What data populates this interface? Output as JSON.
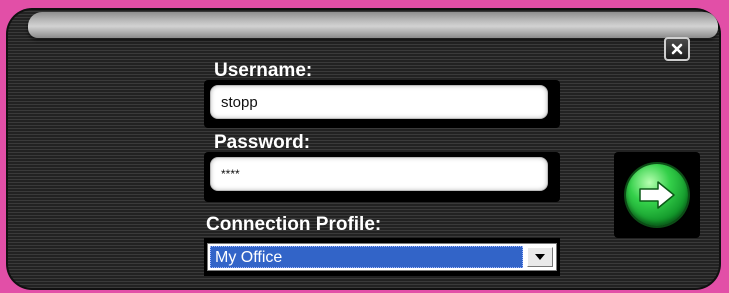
{
  "login": {
    "username_label": "Username:",
    "username_value": "stopp",
    "password_label": "Password:",
    "password_value": "****",
    "profile_label": "Connection Profile:",
    "profile_selected": "My Office"
  },
  "icons": {
    "close": "close-icon",
    "go": "arrow-right-icon",
    "dropdown": "chevron-down-icon"
  },
  "colors": {
    "panel": "#2e2e2e",
    "go_button": "#2fbf3f",
    "selection": "#3264c8",
    "backdrop": "#e24fa7"
  }
}
